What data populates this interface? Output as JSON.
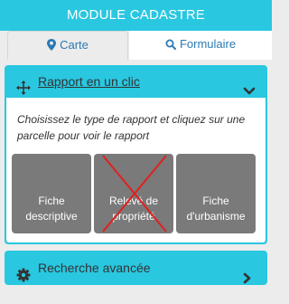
{
  "header": {
    "title": "MODULE CADASTRE"
  },
  "tabs": [
    {
      "label": "Carte",
      "icon": "map-marker-icon",
      "active": true
    },
    {
      "label": "Formulaire",
      "icon": "search-icon",
      "active": false
    }
  ],
  "rapport": {
    "title": "Rapport en un clic",
    "icon": "arrows-move-icon",
    "toggle_icon": "chevron-down-icon",
    "instructions": "Choisissez le type de rapport et cliquez sur une parcelle pour voir le rapport",
    "tiles": [
      {
        "line1": "Fiche",
        "line2": "descriptive",
        "disabled": false
      },
      {
        "line1": "Relevé de",
        "line2": "propriété",
        "disabled": true
      },
      {
        "line1": "Fiche",
        "line2": "d'urbanisme",
        "disabled": false
      }
    ]
  },
  "recherche": {
    "title": "Recherche avancée",
    "icon": "gear-icon",
    "toggle_icon": "chevron-right-icon"
  },
  "colors": {
    "accent": "#29c7e0",
    "tab_text": "#2a7ab3",
    "tile": "#7a7a7a",
    "disabled_cross": "#e02020"
  }
}
